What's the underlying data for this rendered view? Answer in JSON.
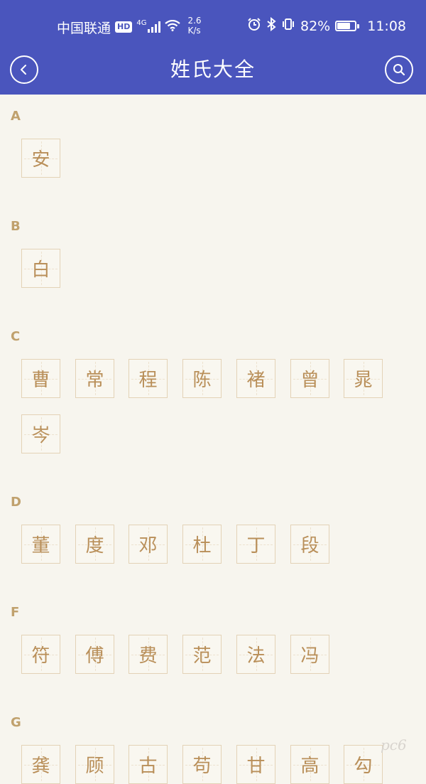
{
  "status_bar": {
    "carrier": "中国联通",
    "hd_badge": "HD",
    "network_type": "4G",
    "speed_value": "2.6",
    "speed_unit": "K/s",
    "battery_percent": "82%",
    "battery_level": 0.82,
    "time": "11:08",
    "icons": [
      "signal-icon",
      "wifi-icon",
      "alarm-icon",
      "bluetooth-icon",
      "vibrate-icon",
      "battery-icon"
    ]
  },
  "nav": {
    "title": "姓氏大全",
    "back_icon": "chevron-left-icon",
    "search_icon": "search-icon"
  },
  "sections": [
    {
      "letter": "A",
      "chars": [
        "安"
      ]
    },
    {
      "letter": "B",
      "chars": [
        "白"
      ]
    },
    {
      "letter": "C",
      "chars": [
        "曹",
        "常",
        "程",
        "陈",
        "褚",
        "曾",
        "晁",
        "岑"
      ]
    },
    {
      "letter": "D",
      "chars": [
        "董",
        "度",
        "邓",
        "杜",
        "丁",
        "段"
      ]
    },
    {
      "letter": "F",
      "chars": [
        "符",
        "傅",
        "费",
        "范",
        "法",
        "冯"
      ]
    },
    {
      "letter": "G",
      "chars": [
        "龚",
        "顾",
        "古",
        "苟",
        "甘",
        "高",
        "勾"
      ]
    }
  ],
  "watermark": "pc6",
  "colors": {
    "header_bg": "#4a55bd",
    "page_bg": "#f7f5ee",
    "accent_gold": "#c0a16d",
    "char_text": "#b98f59",
    "box_border": "#e3d2b6"
  }
}
